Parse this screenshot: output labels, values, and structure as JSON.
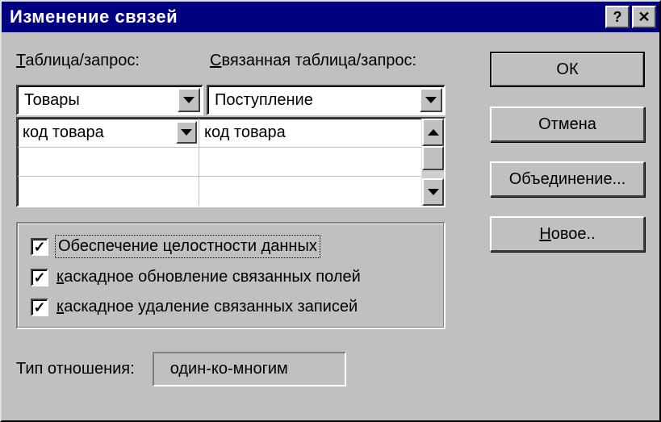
{
  "titlebar": {
    "title": "Изменение связей"
  },
  "labels": {
    "table_query_prefix": "Т",
    "table_query_rest": "аблица/запрос:",
    "related_prefix": "С",
    "related_rest": "вязанная таблица/запрос:"
  },
  "combos": {
    "left_value": "Товары",
    "right_value": "Поступление"
  },
  "grid": {
    "left": [
      "код товара",
      "",
      ""
    ],
    "right": [
      "код товара",
      "",
      ""
    ]
  },
  "checks": {
    "integrity": "Обеспечение целостности данных",
    "cascade_update_prefix": "к",
    "cascade_update_rest": "аскадное обновление связанных полей",
    "cascade_delete_prefix": "к",
    "cascade_delete_rest": "аскадное удаление связанных записей"
  },
  "reltype": {
    "label": "Тип отношения:",
    "value": "один-ко-многим"
  },
  "buttons": {
    "ok": "ОК",
    "cancel": "Отмена",
    "join": "Объединение...",
    "new_prefix": "Н",
    "new_rest": "овое.."
  }
}
